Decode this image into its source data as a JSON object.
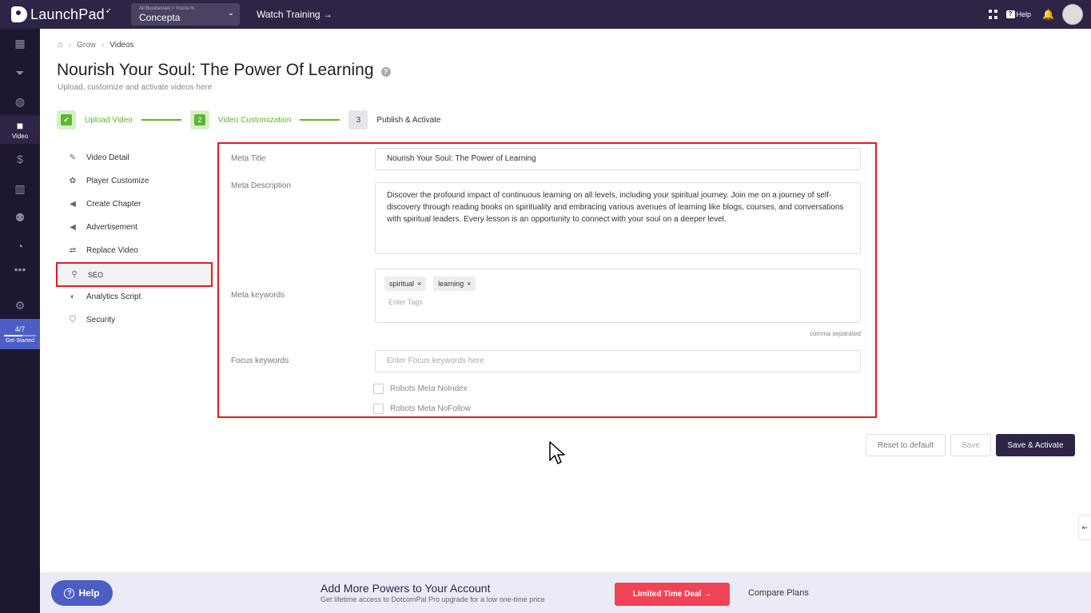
{
  "topbar": {
    "app_name": "LaunchPad",
    "business_small": "All Businesses > You're In",
    "business_name": "Concepta",
    "watch_training": "Watch Training →",
    "help": "Help"
  },
  "sidenav": {
    "active_label": "Video",
    "get_started_count": "4/7",
    "get_started_progress": 0.571,
    "get_started_label": "Get Started"
  },
  "breadcrumb": [
    "Grow",
    "Videos"
  ],
  "page": {
    "title": "Nourish Your Soul: The Power Of Learning",
    "subtitle": "Upload, customize and activate videos here"
  },
  "steps": [
    {
      "number": "",
      "label": "Upload Video",
      "state": "done"
    },
    {
      "number": "2",
      "label": "Video Customization",
      "state": "current"
    },
    {
      "number": "3",
      "label": "Publish & Activate",
      "state": "todo"
    }
  ],
  "menu": [
    {
      "label": "Video Detail",
      "icon": "edit-icon"
    },
    {
      "label": "Player Customize",
      "icon": "palette-icon"
    },
    {
      "label": "Create Chapter",
      "icon": "megaphone-icon"
    },
    {
      "label": "Advertisement",
      "icon": "megaphone-icon"
    },
    {
      "label": "Replace Video",
      "icon": "swap-icon"
    },
    {
      "label": "SEO",
      "icon": "search-icon"
    },
    {
      "label": "Analytics Script",
      "icon": "analytics-icon"
    },
    {
      "label": "Security",
      "icon": "shield-icon"
    }
  ],
  "form": {
    "meta_title_label": "Meta Title",
    "meta_title_value": "Nourish Your Soul: The Power of Learning",
    "meta_desc_label": "Meta Description",
    "meta_desc_value": "Discover the profound impact of continuous learning on all levels, including your spiritual journey. Join me on a journey of self-discovery through reading books on spirituality and embracing various avenues of learning like blogs, courses, and conversations with spiritual leaders. Every lesson is an opportunity to connect with your soul on a deeper level.",
    "meta_kw_label": "Meta keywords",
    "tags": [
      "spiritual",
      "learning"
    ],
    "tags_placeholder": "Enter Tags",
    "comma_hint": "comma separated",
    "focus_label": "Focus keywords",
    "focus_placeholder": "Enter Focus keywords here",
    "noindex_label": "Robots Meta NoIndex",
    "nofollow_label": "Robots Meta NoFollow"
  },
  "buttons": {
    "reset": "Reset to default",
    "save": "Save",
    "save_activate": "Save & Activate"
  },
  "banner": {
    "help": "Help",
    "title": "Add More Powers to Your Account",
    "subtitle": "Get lifetime access to DotcomPal Pro upgrade for a low one-time price",
    "deal": "Limited Time Deal →",
    "compare": "Compare Plans"
  }
}
